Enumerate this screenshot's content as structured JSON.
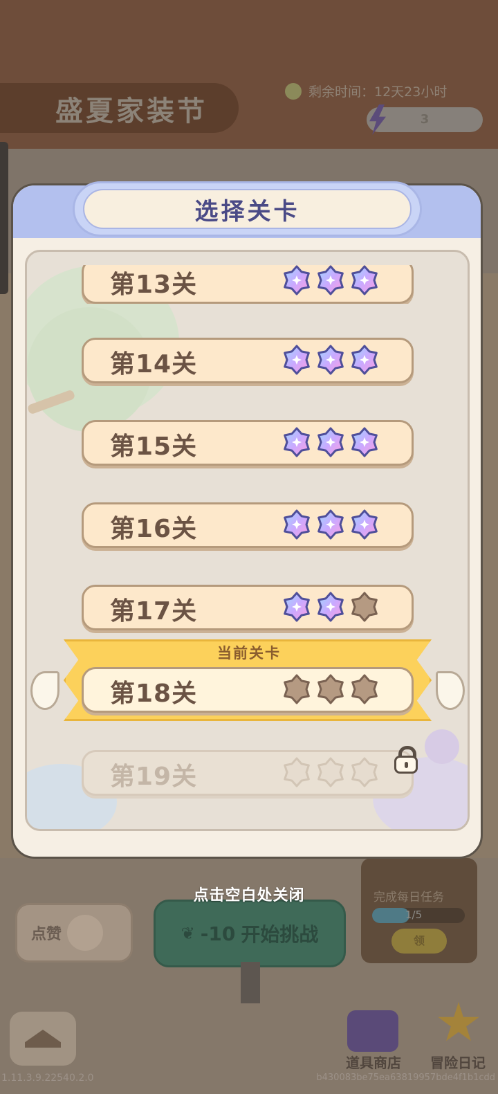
{
  "background": {
    "event_title": "盛夏家装节",
    "timer_label": "剩余时间：12天23小时",
    "energy_value": "3",
    "side_panel_label": "完成每日任务",
    "side_panel_progress": "1/5",
    "side_panel_progress_fraction": 0.4,
    "side_panel_button": "领",
    "left_button_label": "点赞",
    "main_button_cost": "-10",
    "main_button_label": "开始挑战",
    "shop_label": "道具商店",
    "diary_label": "冒险日记",
    "version": "1.11.3.9.22540.2.0",
    "build_hash": "b430083be75ea63819957bde4f1b1cdd"
  },
  "dialog": {
    "title": "选择关卡",
    "current_level_tag": "当前关卡",
    "close_hint": "点击空白处关闭",
    "levels": [
      {
        "label": "第13关",
        "stars": 3,
        "max_stars": 3,
        "state": "completed"
      },
      {
        "label": "第14关",
        "stars": 3,
        "max_stars": 3,
        "state": "completed"
      },
      {
        "label": "第15关",
        "stars": 3,
        "max_stars": 3,
        "state": "completed"
      },
      {
        "label": "第16关",
        "stars": 3,
        "max_stars": 3,
        "state": "completed"
      },
      {
        "label": "第17关",
        "stars": 2,
        "max_stars": 3,
        "state": "completed"
      },
      {
        "label": "第18关",
        "stars": 0,
        "max_stars": 3,
        "state": "current"
      },
      {
        "label": "第19关",
        "stars": 0,
        "max_stars": 3,
        "state": "locked"
      }
    ]
  },
  "colors": {
    "header": "#b3c0ee",
    "title_text": "#4a4a86",
    "row_fill": "#fde8cb",
    "row_text": "#6b5344",
    "current_ribbon": "#fcd15b",
    "star_earned_gradient": [
      "#9ed7ff",
      "#c9a9ff",
      "#ff9fe1"
    ],
    "star_empty": "#b59a82"
  },
  "icons": {
    "star_earned": "sparkle-star-icon",
    "star_empty": "empty-star-icon",
    "lock": "lock-icon",
    "wing": "wing-icon"
  }
}
